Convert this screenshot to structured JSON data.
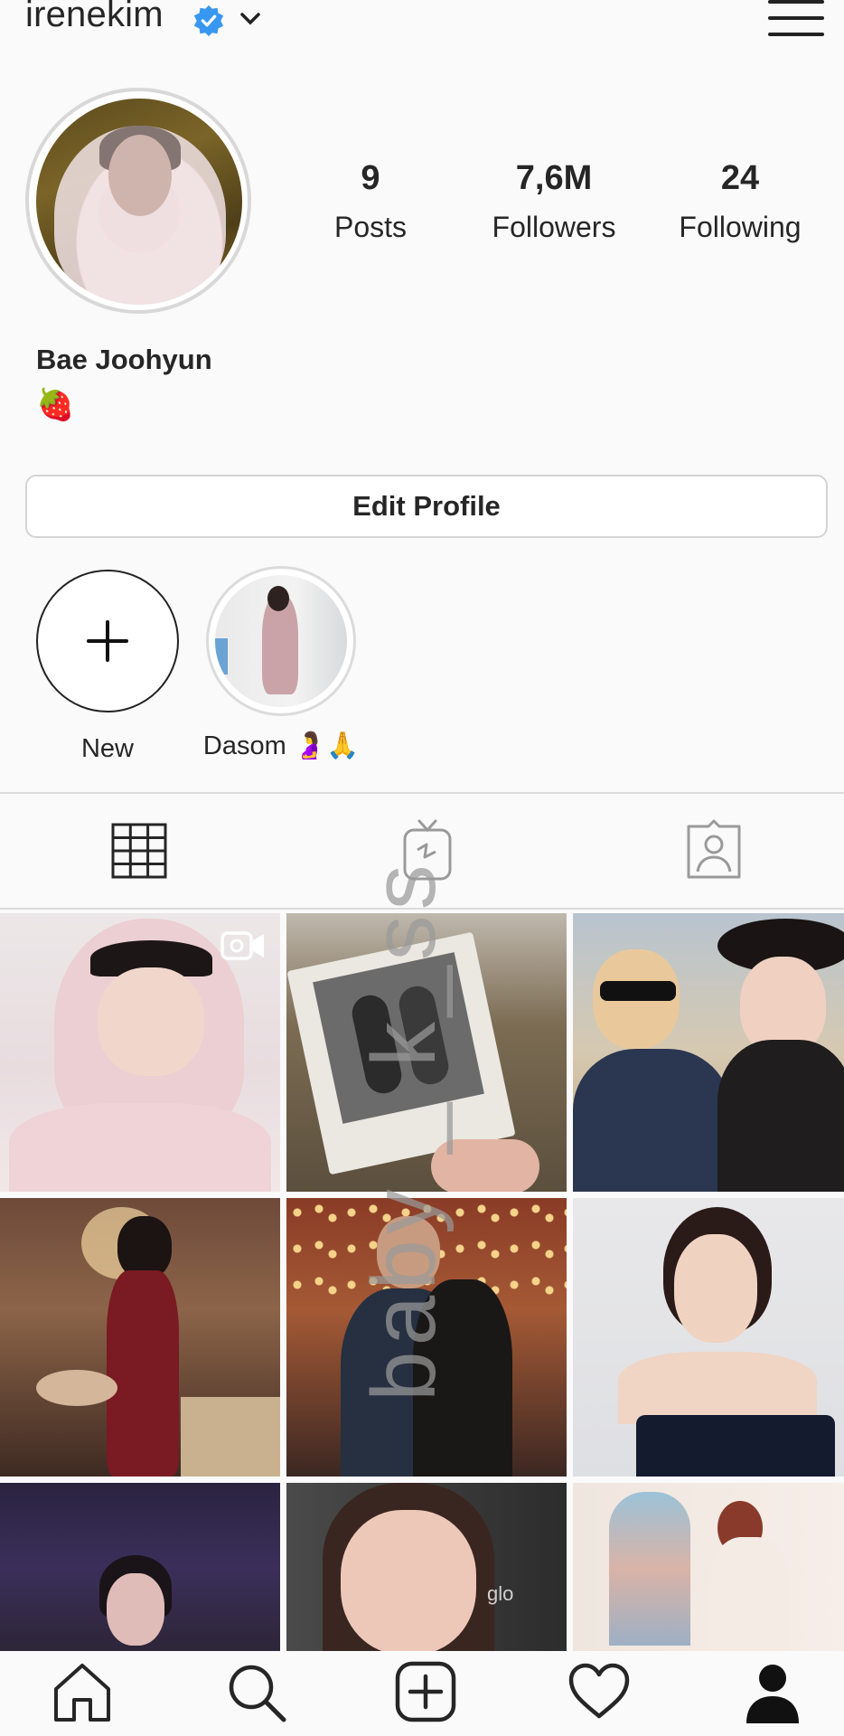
{
  "header": {
    "username": "irenekim",
    "verified_icon": "verified-badge-icon",
    "dropdown_icon": "chevron-down-icon",
    "menu_icon": "hamburger-menu-icon",
    "accent_color": "#3897f0"
  },
  "profile": {
    "stats": [
      {
        "value": "9",
        "label": "Posts"
      },
      {
        "value": "7,6M",
        "label": "Followers"
      },
      {
        "value": "24",
        "label": "Following"
      }
    ],
    "full_name": "Bae Joohyun",
    "bio_emoji": "🍓",
    "edit_button": "Edit Profile"
  },
  "highlights": [
    {
      "label": "New",
      "icon": "plus-icon"
    },
    {
      "label": "Dasom 🤰🙏"
    }
  ],
  "tabs": [
    {
      "name": "grid",
      "icon": "grid-icon"
    },
    {
      "name": "igtv",
      "icon": "igtv-icon"
    },
    {
      "name": "tagged",
      "icon": "tagged-icon"
    }
  ],
  "watermark": "baby _ k_ss",
  "posts": [
    {
      "subject": "child in pink hood",
      "video_icon": "video-camera-icon"
    },
    {
      "subject": "polaroid photo"
    },
    {
      "subject": "couple with sunglasses and hat"
    },
    {
      "subject": "woman in red dress"
    },
    {
      "subject": "couple under lights"
    },
    {
      "subject": "woman in off-shoulder dress"
    },
    {
      "subject": "woman in dark background"
    },
    {
      "subject": "woman portrait",
      "caption": "glo"
    },
    {
      "subject": "woman in white dress by window"
    }
  ],
  "bottom_nav": [
    {
      "icon": "home-icon"
    },
    {
      "icon": "search-icon"
    },
    {
      "icon": "new-post-icon"
    },
    {
      "icon": "heart-icon"
    },
    {
      "icon": "profile-icon"
    }
  ]
}
